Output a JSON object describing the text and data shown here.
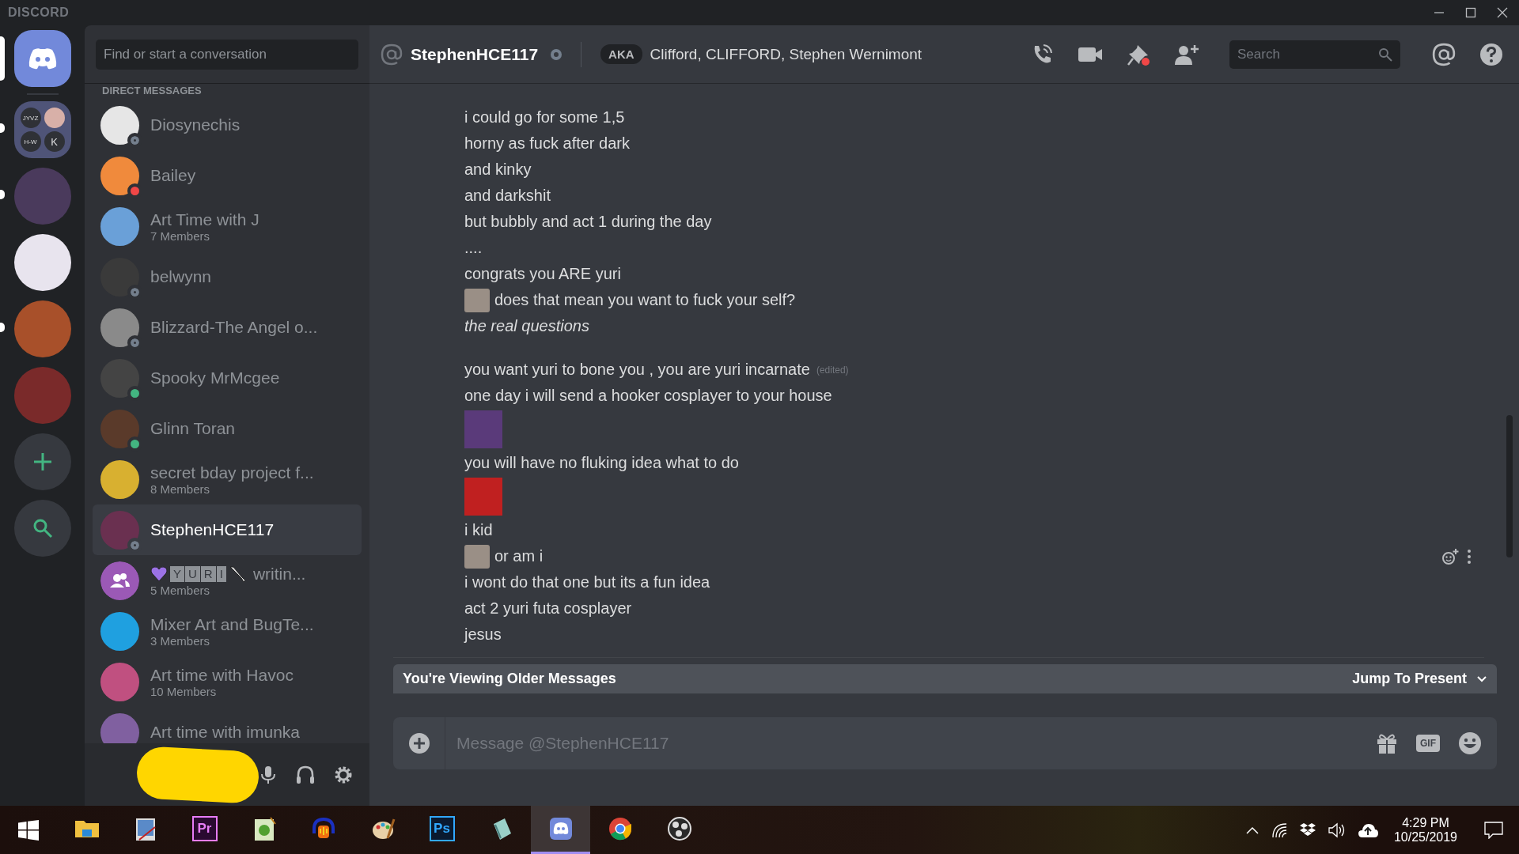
{
  "window": {
    "app_title": "DISCORD"
  },
  "servers": {
    "home": {
      "selected": true
    },
    "folder": {
      "labels": [
        "JYVZ",
        "H-W",
        "K"
      ],
      "unread": true
    },
    "items": [
      {
        "unread": true
      },
      {
        "unread": false
      },
      {
        "unread": true
      },
      {
        "unread": false
      }
    ]
  },
  "dm_sidebar": {
    "search_placeholder": "Find or start a conversation",
    "section_title": "DIRECT MESSAGES",
    "items": [
      {
        "kind": "dm",
        "name": "Diosynechis",
        "status": {
          "color": "#747f8d",
          "ring": true
        },
        "selected": false
      },
      {
        "kind": "dm",
        "name": "Bailey",
        "status": {
          "color": "#f04747",
          "ring": false
        },
        "selected": false
      },
      {
        "kind": "group",
        "name": "Art Time with J",
        "members": "7 Members",
        "selected": false
      },
      {
        "kind": "dm",
        "name": "belwynn",
        "status": {
          "color": "#747f8d",
          "ring": true
        },
        "selected": false
      },
      {
        "kind": "dm",
        "name": "Blizzard-The Angel o...",
        "status": {
          "color": "#747f8d",
          "ring": true
        },
        "selected": false
      },
      {
        "kind": "dm",
        "name": "Spooky MrMcgee",
        "status": {
          "color": "#43b581",
          "ring": false
        },
        "selected": false
      },
      {
        "kind": "dm",
        "name": "Glinn Toran",
        "status": {
          "color": "#43b581",
          "ring": false
        },
        "selected": false
      },
      {
        "kind": "group",
        "name": "secret bday project f...",
        "members": "8 Members",
        "selected": false
      },
      {
        "kind": "dm",
        "name": "StephenHCE117",
        "status": {
          "color": "#747f8d",
          "ring": true
        },
        "selected": true
      },
      {
        "kind": "emoji-group",
        "letters": [
          "Y",
          "U",
          "R",
          "I"
        ],
        "name": "writin...",
        "members": "5 Members",
        "selected": false
      },
      {
        "kind": "group",
        "name": "Mixer Art and BugTe...",
        "members": "3 Members",
        "selected": false
      },
      {
        "kind": "group",
        "name": "Art time with Havoc",
        "members": "10 Members",
        "selected": false
      },
      {
        "kind": "group",
        "name": "Art time with imunka",
        "selected": false
      }
    ]
  },
  "user_panel": {
    "redacted": true
  },
  "header": {
    "name": "StephenHCE117",
    "status": {
      "color": "#747f8d",
      "ring": true
    },
    "aka_label": "AKA",
    "aka_names": "Clifford, CLIFFORD, Stephen Wernimont",
    "pin_alert": true,
    "search_placeholder": "Search"
  },
  "messages": [
    {
      "kind": "text",
      "text": "i could go for some 1,5"
    },
    {
      "kind": "text",
      "text": "horny as fuck after dark"
    },
    {
      "kind": "text",
      "text": "and kinky"
    },
    {
      "kind": "text",
      "text": "and darkshit"
    },
    {
      "kind": "text",
      "text": "but bubbly and act 1 during the day"
    },
    {
      "kind": "text",
      "text": "...."
    },
    {
      "kind": "text",
      "text": "congrats you ARE yuri"
    },
    {
      "kind": "text",
      "text": "does that mean you want to fuck your self?",
      "inline_image": true
    },
    {
      "kind": "text",
      "text": "the real questions",
      "italic": true
    },
    {
      "kind": "text",
      "text": "you want yuri to bone you , you are yuri incarnate",
      "edited": "(edited)",
      "group_start": true
    },
    {
      "kind": "text",
      "text": "one day i will send a hooker cosplayer to your house"
    },
    {
      "kind": "image"
    },
    {
      "kind": "text",
      "text": "you will have no fluking idea what to do"
    },
    {
      "kind": "image"
    },
    {
      "kind": "text",
      "text": "i kid"
    },
    {
      "kind": "text",
      "text": "or am i",
      "inline_image": true,
      "hovered": true
    },
    {
      "kind": "text",
      "text": "i wont do that one but its a fun idea"
    },
    {
      "kind": "text",
      "text": "act 2 yuri futa cosplayer"
    },
    {
      "kind": "text",
      "text": "jesus"
    }
  ],
  "older_bar": {
    "label": "You're Viewing Older Messages",
    "jump_label": "Jump To Present"
  },
  "composer": {
    "placeholder": "Message @StephenHCE117",
    "gif_label": "GIF"
  },
  "taskbar": {
    "apps": [
      {
        "selected": false
      },
      {
        "selected": false
      },
      {
        "label": "Pr",
        "selected": false
      },
      {
        "selected": false
      },
      {
        "selected": false
      },
      {
        "selected": false
      },
      {
        "label": "Ps",
        "selected": false
      },
      {
        "selected": false
      },
      {
        "selected": true
      },
      {
        "selected": false
      },
      {
        "selected": false
      }
    ],
    "time": "4:29 PM",
    "date": "10/25/2019"
  }
}
